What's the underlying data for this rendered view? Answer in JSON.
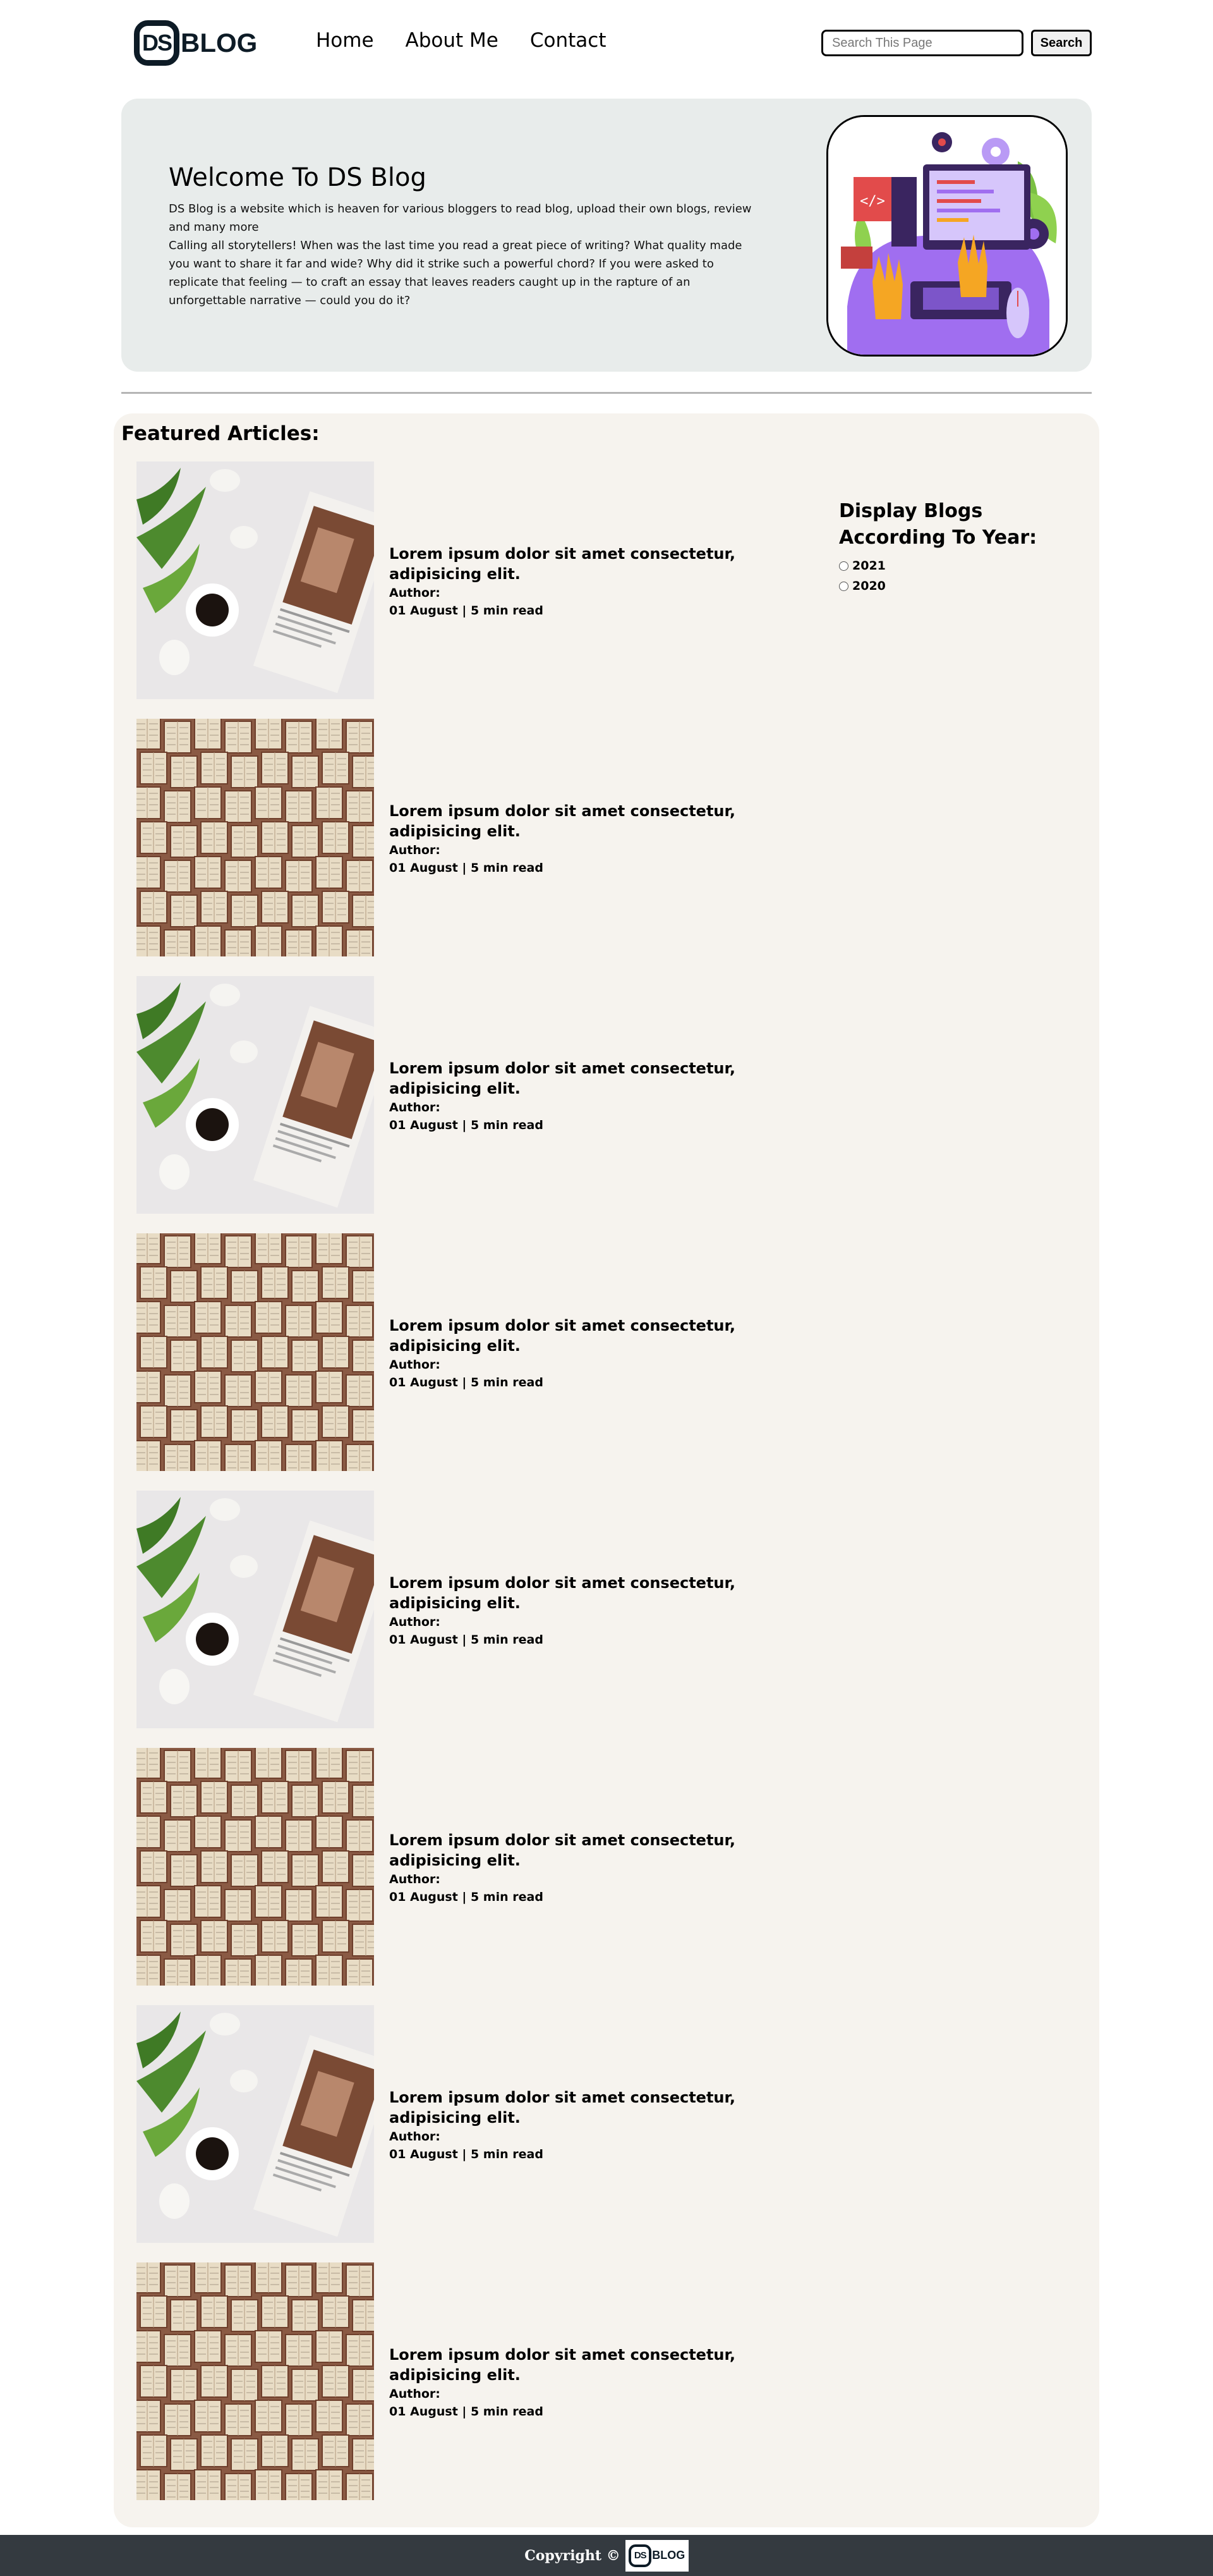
{
  "header": {
    "logo": {
      "mark": "DS",
      "word": "BLOG"
    },
    "nav": [
      {
        "label": "Home"
      },
      {
        "label": "About Me"
      },
      {
        "label": "Contact"
      }
    ],
    "search": {
      "placeholder": "Search This Page",
      "button_label": "Search"
    }
  },
  "hero": {
    "title": "Welcome To DS Blog",
    "text": "DS Blog is a website which is heaven for various bloggers to read blog, upload their own blogs, review and many more\nCalling all storytellers! When was the last time you read a great piece of writing? What quality made you want to share it far and wide? Why did it strike such a powerful chord? If you were asked to replicate that feeling — to craft an essay that leaves readers caught up in the rapture of an unforgettable narrative — could you do it?",
    "image_icon": "laptop-illustration-icon"
  },
  "featured": {
    "title": "Featured Articles:",
    "articles": [
      {
        "title": "Lorem ipsum dolor sit amet consectetur, adipisicing elit.",
        "author": "Author:",
        "meta": "01 August | 5 min read",
        "image": "coffee-flowers-photo"
      },
      {
        "title": "Lorem ipsum dolor sit amet consectetur, adipisicing elit.",
        "author": "Author:",
        "meta": "01 August | 5 min read",
        "image": "books-photo"
      },
      {
        "title": "Lorem ipsum dolor sit amet consectetur, adipisicing elit.",
        "author": "Author:",
        "meta": "01 August | 5 min read",
        "image": "coffee-flowers-photo"
      },
      {
        "title": "Lorem ipsum dolor sit amet consectetur, adipisicing elit.",
        "author": "Author:",
        "meta": "01 August | 5 min read",
        "image": "books-photo"
      },
      {
        "title": "Lorem ipsum dolor sit amet consectetur, adipisicing elit.",
        "author": "Author:",
        "meta": "01 August | 5 min read",
        "image": "coffee-flowers-photo"
      },
      {
        "title": "Lorem ipsum dolor sit amet consectetur, adipisicing elit.",
        "author": "Author:",
        "meta": "01 August | 5 min read",
        "image": "books-photo"
      },
      {
        "title": "Lorem ipsum dolor sit amet consectetur, adipisicing elit.",
        "author": "Author:",
        "meta": "01 August | 5 min read",
        "image": "coffee-flowers-photo"
      },
      {
        "title": "Lorem ipsum dolor sit amet consectetur, adipisicing elit.",
        "author": "Author:",
        "meta": "01 August | 5 min read",
        "image": "books-photo"
      }
    ]
  },
  "sidebar": {
    "title": "Display Blogs According To Year:",
    "years": [
      {
        "label": "2021",
        "selected": false
      },
      {
        "label": "2020",
        "selected": false
      }
    ]
  },
  "footer": {
    "text": "Copyright ©",
    "logo": {
      "mark": "DS",
      "word": "BLOG"
    }
  },
  "colors": {
    "hero_bg": "#e8eceb",
    "main_bg": "#f6f3ee",
    "footer_bg": "#343a40",
    "logo_dark": "#0d1b26",
    "accent_purple": "#a06ef0"
  }
}
